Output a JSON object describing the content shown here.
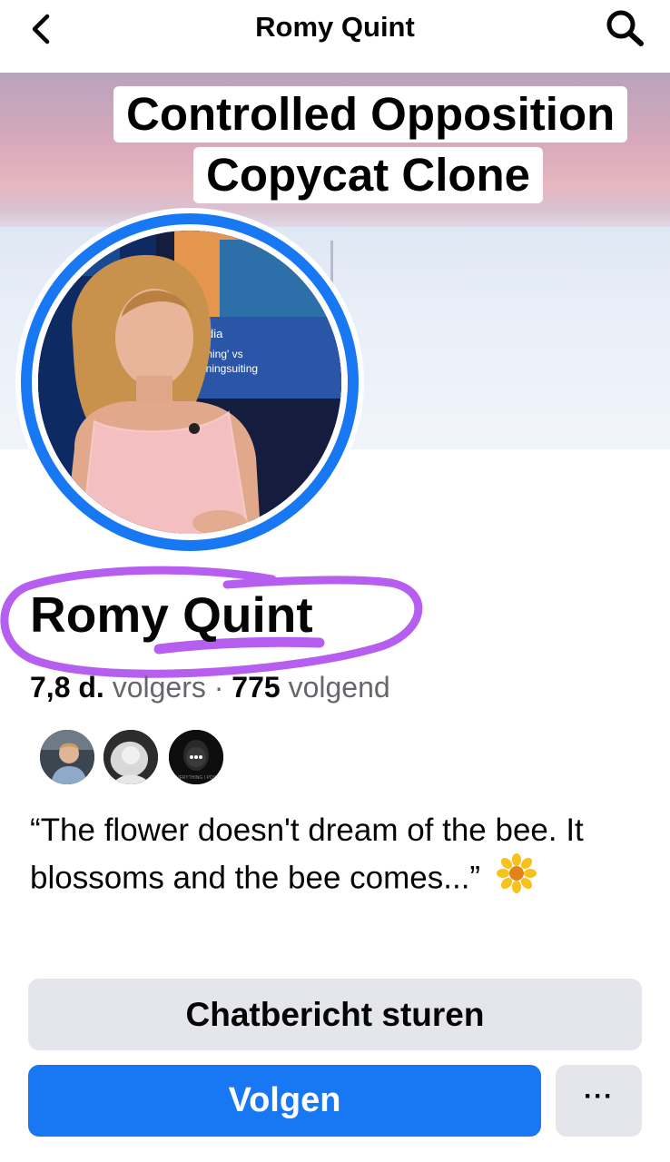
{
  "nav": {
    "title": "Romy Quint"
  },
  "cover": {
    "overlay_line1": "Controlled Opposition",
    "overlay_line2": "Copycat Clone"
  },
  "avatar_photo": {
    "backdrop_text_line1": "Media",
    "backdrop_text_line2": "forming' vs",
    "backdrop_text_line3": "meningsuiting"
  },
  "profile": {
    "name": "Romy Quint",
    "followers_value": "7,8 d.",
    "followers_label": "volgers",
    "separator": "·",
    "following_value": "775",
    "following_label": "volgend",
    "bio": "“The flower doesn't dream of the bee. It blossoms and the bee comes...”"
  },
  "mutuals": [
    {
      "name": "mutual-friend-1"
    },
    {
      "name": "mutual-friend-2"
    },
    {
      "name": "mutual-friend-3",
      "caption": "EVERYTHING I POST"
    }
  ],
  "actions": {
    "message_label": "Chatbericht sturen",
    "follow_label": "Volgen",
    "more_label": "···"
  },
  "colors": {
    "accent": "#1877f2",
    "secondary_button": "#e4e6eb",
    "annotation": "#b65ef0"
  },
  "icons": {
    "back": "chevron-left-icon",
    "search": "search-icon",
    "bio_emoji": "sunflower-icon"
  }
}
